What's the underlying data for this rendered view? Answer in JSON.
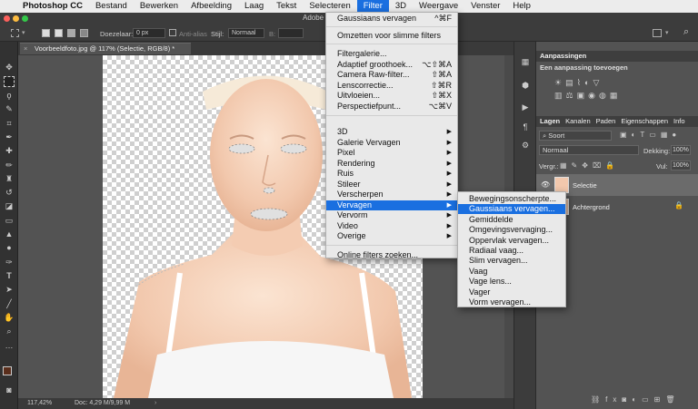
{
  "menubar": {
    "apple": "",
    "items": [
      "Photoshop CC",
      "Bestand",
      "Bewerken",
      "Afbeelding",
      "Laag",
      "Tekst",
      "Selecteren",
      "Filter",
      "3D",
      "Weergave",
      "Venster",
      "Help"
    ]
  },
  "optionsbar": {
    "feather_label": "Doezelaar:",
    "feather_value": "0 px",
    "antialias_label": "Anti-alias",
    "style_label": "Stijl:",
    "style_value": "Normaal",
    "width_label": "B:",
    "window_title": "Adobe"
  },
  "document": {
    "tab_title": "Voorbeeldfoto.jpg @ 117% (Selectie, RGB/8) *",
    "zoom": "117,42%",
    "doc_info": "Doc: 4,29 M/9,99 M"
  },
  "filter_menu": {
    "items": [
      {
        "label": "Gaussiaans vervagen",
        "shortcut": "^⌘F"
      },
      {
        "label": "Omzetten voor slimme filters",
        "shortcut": ""
      },
      {
        "label": "Filtergalerie...",
        "shortcut": ""
      },
      {
        "label": "Adaptief groothoek...",
        "shortcut": "⌥⇧⌘A"
      },
      {
        "label": "Camera Raw-filter...",
        "shortcut": "⇧⌘A"
      },
      {
        "label": "Lenscorrectie...",
        "shortcut": "⇧⌘R"
      },
      {
        "label": "Uitvloeien...",
        "shortcut": "⇧⌘X"
      },
      {
        "label": "Perspectiefpunt...",
        "shortcut": "⌥⌘V"
      },
      {
        "label": "3D",
        "shortcut": "▶"
      },
      {
        "label": "Galerie Vervagen",
        "shortcut": "▶"
      },
      {
        "label": "Pixel",
        "shortcut": "▶"
      },
      {
        "label": "Rendering",
        "shortcut": "▶"
      },
      {
        "label": "Ruis",
        "shortcut": "▶"
      },
      {
        "label": "Stileer",
        "shortcut": "▶"
      },
      {
        "label": "Verscherpen",
        "shortcut": "▶"
      },
      {
        "label": "Vervagen",
        "shortcut": "▶"
      },
      {
        "label": "Vervorm",
        "shortcut": "▶"
      },
      {
        "label": "Video",
        "shortcut": "▶"
      },
      {
        "label": "Overige",
        "shortcut": "▶"
      },
      {
        "label": "Online filters zoeken...",
        "shortcut": ""
      }
    ]
  },
  "blur_submenu": {
    "items": [
      "Bewegingsonscherpte...",
      "Gaussiaans vervagen...",
      "Gemiddelde",
      "Omgevingsvervaging...",
      "Oppervlak vervagen...",
      "Radiaal vaag...",
      "Slim vervagen...",
      "Vaag",
      "Vage lens...",
      "Vager",
      "Vorm vervagen..."
    ]
  },
  "adjustments": {
    "title": "Aanpassingen",
    "subtitle": "Een aanpassing toevoegen"
  },
  "layers_panel": {
    "tabs": [
      "Lagen",
      "Kanalen",
      "Paden",
      "Eigenschappen",
      "Info"
    ],
    "kind_label": "Soort",
    "blend_mode": "Normaal",
    "opacity_label": "Dekking:",
    "opacity_value": "100%",
    "lock_label": "Vergr.:",
    "fill_label": "Vul:",
    "fill_value": "100%",
    "layers": [
      {
        "name": "Selectie"
      },
      {
        "name": "Achtergrond"
      }
    ]
  },
  "colors": {
    "accent": "#1a6fe0",
    "foreground": "#5a2e1c",
    "background": "#ffffff"
  }
}
